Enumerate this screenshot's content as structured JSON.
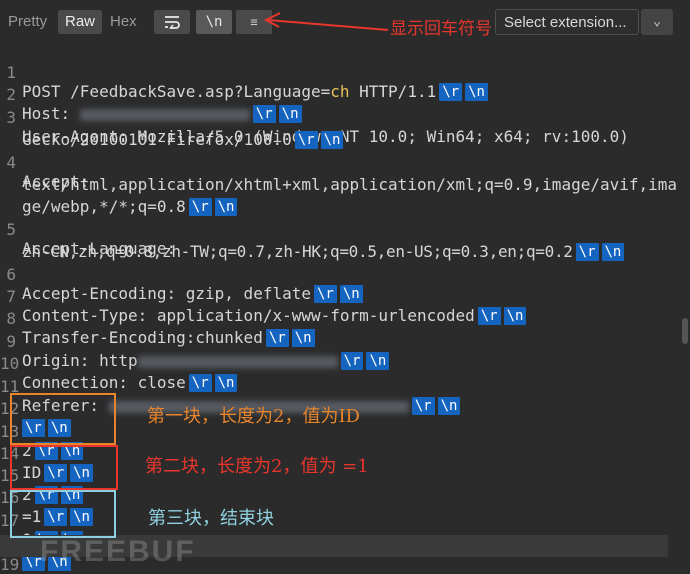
{
  "toolbar": {
    "tabs": [
      "Pretty",
      "Raw",
      "Hex"
    ],
    "active_tab": "Raw",
    "newline_button": "\\n",
    "select_extension": "Select extension...",
    "annotation": "显示回车符号"
  },
  "crlf": {
    "r": "\\r",
    "n": "\\n"
  },
  "lines": [
    {
      "num": "1",
      "parts": [
        "POST /FeedbackSave.asp?Language=",
        "ch",
        " HTTP/1.1"
      ]
    },
    {
      "num": "2",
      "text": "Host: "
    },
    {
      "num": "3",
      "text": "User-Agent: Mozilla/5.0 (Windows NT 10.0; Win64; x64; rv:100.0)",
      "cont": "Gecko/20100101 Firefox/100.0"
    },
    {
      "num": "4",
      "text": "Accept:",
      "cont": "text/html,application/xhtml+xml,application/xml;q=0.9,image/avif,ima",
      "cont2": "ge/webp,*/*;q=0.8"
    },
    {
      "num": "5",
      "text": "Accept-Language:",
      "cont": "zh-CN,zh;q=0.8,zh-TW;q=0.7,zh-HK;q=0.5,en-US;q=0.3,en;q=0.2"
    },
    {
      "num": "6",
      "text": "Accept-Encoding: gzip, deflate"
    },
    {
      "num": "7",
      "text": "Content-Type: application/x-www-form-urlencoded"
    },
    {
      "num": "8",
      "text": "Transfer-Encoding:chunked"
    },
    {
      "num": "9",
      "text": "Origin: http"
    },
    {
      "num": "10",
      "text": "Connection: close"
    },
    {
      "num": "11",
      "text": "Referer: "
    },
    {
      "num": "12",
      "text": ""
    },
    {
      "num": "13",
      "text": "2"
    },
    {
      "num": "14",
      "text": "ID"
    },
    {
      "num": "15",
      "text": "2"
    },
    {
      "num": "16",
      "text": "=1"
    },
    {
      "num": "17",
      "text": "0"
    },
    {
      "num": "18",
      "text": ""
    },
    {
      "num": "19",
      "text": ""
    }
  ],
  "annotations": {
    "chunk1": "第一块，长度为2，值为ID",
    "chunk2": "第二块，长度为2，值为 =1",
    "chunk3": "第三块，结束块",
    "chunk1_color": "#e8842a",
    "chunk2_color": "#e8362d",
    "chunk3_color": "#8fd0e0"
  },
  "watermark": "FREEBUF"
}
